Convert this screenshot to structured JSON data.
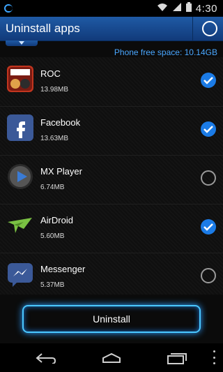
{
  "status_bar": {
    "time": "4:30"
  },
  "header": {
    "title": "Uninstall apps"
  },
  "free_space": {
    "text": "Phone free space: 10.14GB"
  },
  "apps": [
    {
      "name": "ROC",
      "size": "13.98MB",
      "checked": true
    },
    {
      "name": "Facebook",
      "size": "13.63MB",
      "checked": true
    },
    {
      "name": "MX Player",
      "size": "6.74MB",
      "checked": false
    },
    {
      "name": "AirDroid",
      "size": "5.60MB",
      "checked": true
    },
    {
      "name": "Messenger",
      "size": "5.37MB",
      "checked": false
    }
  ],
  "actions": {
    "uninstall_label": "Uninstall"
  },
  "colors": {
    "accent": "#4ac7ff",
    "header_blue": "#1f5aa5",
    "checked_blue": "#1b7be6",
    "free_space_blue": "#4aa7ff"
  },
  "icons": {
    "status_left": "app-notification-icon",
    "wifi": "wifi-icon",
    "signal": "signal-icon",
    "battery": "battery-icon",
    "nav_back": "back-icon",
    "nav_home": "home-icon",
    "nav_recents": "recents-icon",
    "nav_overflow": "overflow-menu-icon"
  }
}
